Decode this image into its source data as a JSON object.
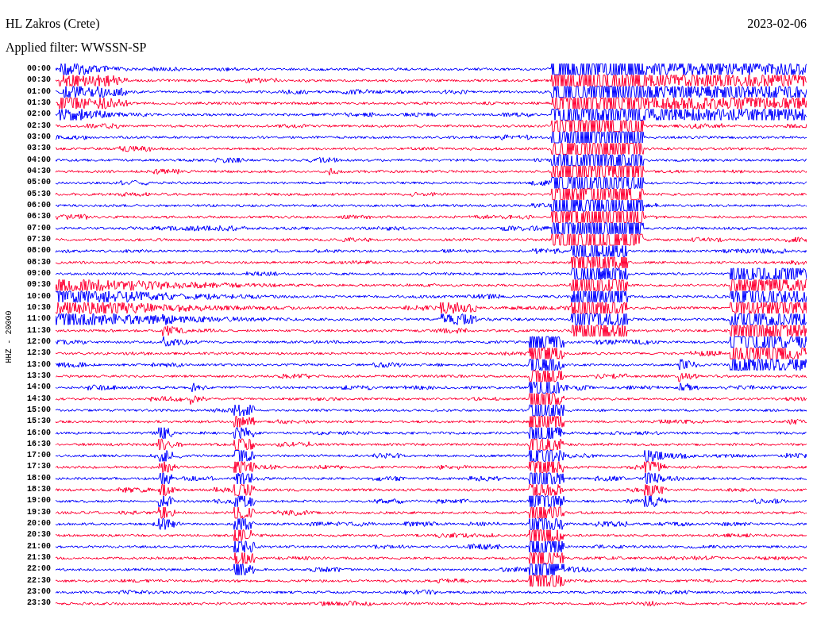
{
  "header": {
    "station": "HL Zakros (Crete)",
    "filter": "Applied filter: WWSSN-SP",
    "date": "2023-02-06"
  },
  "channel_label": "HHZ - 20000",
  "rows": [
    {
      "time": "00:00",
      "color": "#0000ff"
    },
    {
      "time": "00:30",
      "color": "#ff0033"
    },
    {
      "time": "01:00",
      "color": "#0000ff"
    },
    {
      "time": "01:30",
      "color": "#ff0033"
    },
    {
      "time": "02:00",
      "color": "#0000ff"
    },
    {
      "time": "02:30",
      "color": "#ff0033"
    },
    {
      "time": "03:00",
      "color": "#0000ff"
    },
    {
      "time": "03:30",
      "color": "#ff0033"
    },
    {
      "time": "04:00",
      "color": "#0000ff"
    },
    {
      "time": "04:30",
      "color": "#ff0033"
    },
    {
      "time": "05:00",
      "color": "#0000ff"
    },
    {
      "time": "05:30",
      "color": "#ff0033"
    },
    {
      "time": "06:00",
      "color": "#0000ff"
    },
    {
      "time": "06:30",
      "color": "#ff0033"
    },
    {
      "time": "07:00",
      "color": "#0000ff"
    },
    {
      "time": "07:30",
      "color": "#ff0033"
    },
    {
      "time": "08:00",
      "color": "#0000ff"
    },
    {
      "time": "08:30",
      "color": "#ff0033"
    },
    {
      "time": "09:00",
      "color": "#0000ff"
    },
    {
      "time": "09:30",
      "color": "#ff0033"
    },
    {
      "time": "10:00",
      "color": "#0000ff"
    },
    {
      "time": "10:30",
      "color": "#ff0033"
    },
    {
      "time": "11:00",
      "color": "#0000ff"
    },
    {
      "time": "11:30",
      "color": "#ff0033"
    },
    {
      "time": "12:00",
      "color": "#0000ff"
    },
    {
      "time": "12:30",
      "color": "#ff0033"
    },
    {
      "time": "13:00",
      "color": "#0000ff"
    },
    {
      "time": "13:30",
      "color": "#ff0033"
    },
    {
      "time": "14:00",
      "color": "#0000ff"
    },
    {
      "time": "14:30",
      "color": "#ff0033"
    },
    {
      "time": "15:00",
      "color": "#0000ff"
    },
    {
      "time": "15:30",
      "color": "#ff0033"
    },
    {
      "time": "16:00",
      "color": "#0000ff"
    },
    {
      "time": "16:30",
      "color": "#ff0033"
    },
    {
      "time": "17:00",
      "color": "#0000ff"
    },
    {
      "time": "17:30",
      "color": "#ff0033"
    },
    {
      "time": "18:00",
      "color": "#0000ff"
    },
    {
      "time": "18:30",
      "color": "#ff0033"
    },
    {
      "time": "19:00",
      "color": "#0000ff"
    },
    {
      "time": "19:30",
      "color": "#ff0033"
    },
    {
      "time": "20:00",
      "color": "#0000ff"
    },
    {
      "time": "20:30",
      "color": "#ff0033"
    },
    {
      "time": "21:00",
      "color": "#0000ff"
    },
    {
      "time": "21:30",
      "color": "#ff0033"
    },
    {
      "time": "22:00",
      "color": "#0000ff"
    },
    {
      "time": "22:30",
      "color": "#ff0033"
    },
    {
      "time": "23:00",
      "color": "#0000ff"
    },
    {
      "time": "23:30",
      "color": "#ff0033"
    }
  ]
}
